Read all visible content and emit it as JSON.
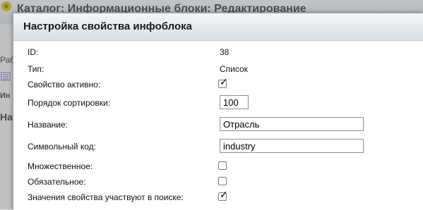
{
  "background": {
    "title": "Каталог: Информационные блоки: Редактирование",
    "strip_text_1": "Раб",
    "strip_text_2": "Ин",
    "strip_text_3": "На"
  },
  "dialog": {
    "title": "Настройка свойства инфоблока",
    "fields": {
      "id": {
        "label": "ID:",
        "value": "38"
      },
      "type": {
        "label": "Тип:",
        "value": "Список"
      },
      "active": {
        "label": "Свойство активно:",
        "checked": true
      },
      "sort": {
        "label": "Порядок сортировки:",
        "value": "100"
      },
      "name": {
        "label": "Название:",
        "value": "Отрасль"
      },
      "code": {
        "label": "Символьный код:",
        "value": "industry"
      },
      "multiple": {
        "label": "Множественное:",
        "checked": false
      },
      "required": {
        "label": "Обязательное:",
        "checked": false
      },
      "searchable": {
        "label": "Значения свойства участвуют в поиске:",
        "checked": true
      }
    }
  },
  "checkmark_glyph": "✓",
  "icons": {
    "logo": "gear-logo-icon"
  }
}
